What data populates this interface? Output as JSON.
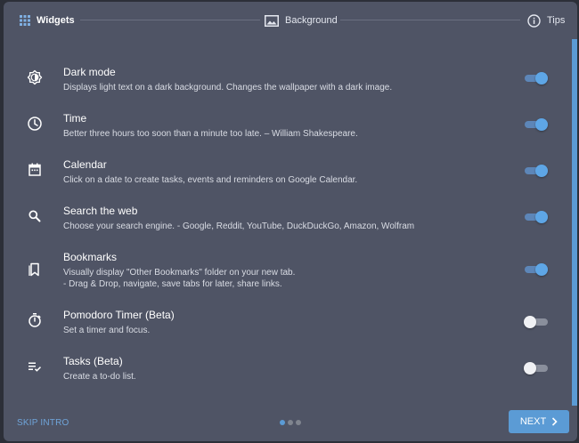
{
  "stepper": {
    "steps": [
      {
        "label": "Widgets",
        "icon": "grid-icon",
        "active": true
      },
      {
        "label": "Background",
        "icon": "image-icon",
        "active": false
      },
      {
        "label": "Tips",
        "icon": "info-icon",
        "active": false
      }
    ]
  },
  "widgets": [
    {
      "title": "Dark mode",
      "description": [
        "Displays light text on a dark background. Changes the wallpaper with a dark image."
      ],
      "icon": "brightness-icon",
      "enabled": true
    },
    {
      "title": "Time",
      "description": [
        "Better three hours too soon than a minute too late. – William Shakespeare."
      ],
      "icon": "clock-icon",
      "enabled": true
    },
    {
      "title": "Calendar",
      "description": [
        "Click on a date to create tasks, events and reminders on Google Calendar."
      ],
      "icon": "calendar-icon",
      "enabled": true
    },
    {
      "title": "Search the web",
      "description": [
        "Choose your search engine. - Google, Reddit, YouTube, DuckDuckGo, Amazon, Wolfram"
      ],
      "icon": "search-icon",
      "enabled": true
    },
    {
      "title": "Bookmarks",
      "description": [
        "Visually display \"Other Bookmarks\" folder on your new tab.",
        "- Drag & Drop, navigate, save tabs for later, share links."
      ],
      "icon": "bookmark-icon",
      "enabled": true
    },
    {
      "title": "Pomodoro Timer (Beta)",
      "description": [
        "Set a timer and focus."
      ],
      "icon": "timer-icon",
      "enabled": false
    },
    {
      "title": "Tasks (Beta)",
      "description": [
        "Create a to-do list."
      ],
      "icon": "checklist-icon",
      "enabled": false
    }
  ],
  "footer": {
    "skip_label": "SKIP INTRO",
    "next_label": "NEXT",
    "page_count": 3,
    "current_page": 1
  },
  "colors": {
    "accent": "#5b9bd5",
    "panel": "#4f5465",
    "toggle_on_knob": "#5ea6e6",
    "toggle_off_track": "#8a8f9c"
  }
}
